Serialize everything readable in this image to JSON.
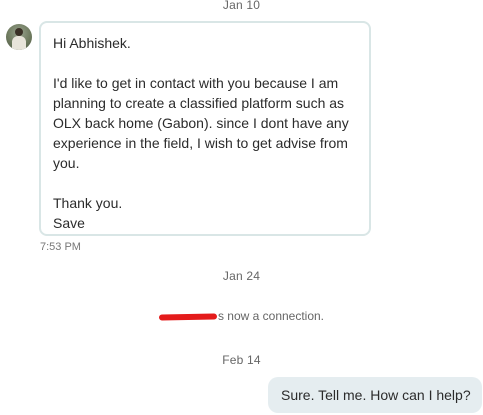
{
  "conversation": {
    "dates": {
      "first": "Jan 10",
      "second": "Jan 24",
      "third": "Feb 14"
    },
    "incoming_message": {
      "lines": [
        "Hi Abhishek.",
        "I'd like to get in contact with you because I am planning to create a classified platform such as OLX back home (Gabon). since I dont have any experience in the field, I wish to get advise from you.",
        "Thank you.",
        "Save"
      ],
      "time": "7:53 PM"
    },
    "connection_notice": {
      "text": "s now a connection."
    },
    "outgoing_message": {
      "text": "Sure. Tell me. How can I help?"
    },
    "colors": {
      "redaction": "#e41b1b",
      "incoming_border": "#d9e6e6",
      "outgoing_background": "#e5edf0"
    },
    "icons": {
      "sender_avatar": "profile-photo-avatar"
    }
  }
}
